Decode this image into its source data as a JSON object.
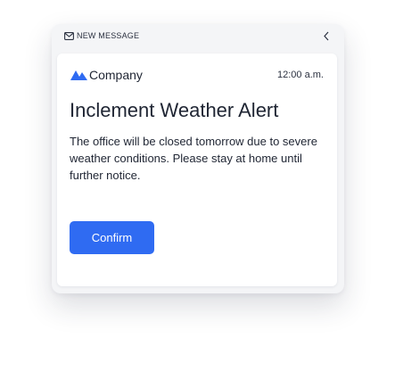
{
  "header": {
    "label": "NEW MESSAGE",
    "icon": "envelope-icon",
    "collapse_icon": "chevron-left-icon"
  },
  "brand": {
    "name": "Company",
    "logo_icon": "mountain-logo-icon"
  },
  "time": "12:00 a.m.",
  "alert": {
    "title": "Inclement Weather Alert",
    "message": "The office will be closed tomorrow due to severe weather conditions. Please stay at home until further notice."
  },
  "actions": {
    "confirm_label": "Confirm"
  },
  "colors": {
    "accent": "#2f6bf2",
    "text": "#1f2533",
    "panel_background": "#f4f5f7",
    "card_background": "#ffffff"
  }
}
